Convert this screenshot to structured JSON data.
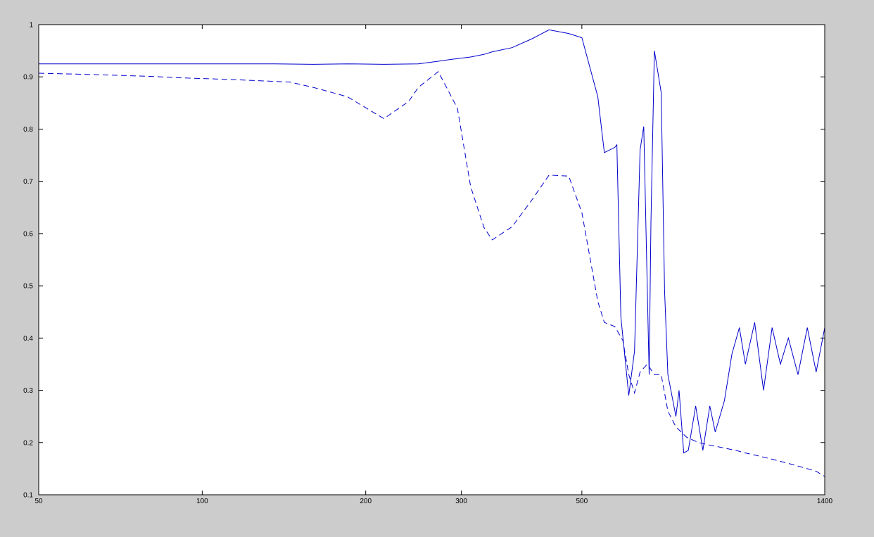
{
  "chart_data": {
    "type": "line",
    "title": "",
    "xlabel": "",
    "ylabel": "",
    "x_scale": "log",
    "xlim": [
      50,
      1400
    ],
    "ylim": [
      0.1,
      1.0
    ],
    "x_ticks": [
      50,
      100,
      200,
      300,
      500,
      1400
    ],
    "x_tick_labels": [
      "50",
      "100",
      "200",
      "300",
      "500",
      "1400"
    ],
    "y_ticks": [
      0.1,
      0.2,
      0.3,
      0.4,
      0.5,
      0.6,
      0.7,
      0.8,
      0.9,
      1.0
    ],
    "y_tick_labels": [
      "0.1",
      "0.2",
      "0.3",
      "0.4",
      "0.5",
      "0.6",
      "0.7",
      "0.8",
      "0.9",
      "1"
    ],
    "grid": false,
    "legend": false,
    "colors": {
      "series": "#0000cc",
      "figure_bg": "#cccccc",
      "axes_bg": "#ffffff",
      "axes": "#000000"
    },
    "series": [
      {
        "style": "solid",
        "x": [
          50,
          65,
          80,
          106,
          136,
          160,
          185,
          216,
          250,
          272,
          295,
          312,
          330,
          342,
          372,
          405,
          435,
          473,
          500,
          535,
          550,
          575,
          580,
          590,
          610,
          625,
          640,
          650,
          665,
          670,
          680,
          700,
          710,
          720,
          745,
          755,
          770,
          785,
          810,
          835,
          860,
          880,
          915,
          945,
          975,
          1000,
          1040,
          1080,
          1120,
          1160,
          1200,
          1250,
          1300,
          1350,
          1400
        ],
        "y": [
          0.925,
          0.925,
          0.925,
          0.925,
          0.925,
          0.924,
          0.925,
          0.924,
          0.925,
          0.93,
          0.935,
          0.938,
          0.943,
          0.948,
          0.956,
          0.973,
          0.99,
          0.983,
          0.975,
          0.862,
          0.755,
          0.765,
          0.77,
          0.44,
          0.29,
          0.375,
          0.76,
          0.805,
          0.33,
          0.62,
          0.95,
          0.87,
          0.49,
          0.33,
          0.25,
          0.3,
          0.18,
          0.185,
          0.27,
          0.185,
          0.27,
          0.22,
          0.28,
          0.37,
          0.42,
          0.35,
          0.43,
          0.3,
          0.42,
          0.35,
          0.4,
          0.33,
          0.42,
          0.335,
          0.42
        ]
      },
      {
        "style": "dashed",
        "x": [
          50,
          60,
          70,
          80,
          92,
          106,
          125,
          145,
          160,
          185,
          216,
          240,
          250,
          272,
          295,
          312,
          330,
          342,
          372,
          405,
          435,
          473,
          500,
          535,
          550,
          575,
          595,
          610,
          625,
          640,
          660,
          680,
          700,
          720,
          745,
          780,
          820,
          860,
          910,
          960,
          1000,
          1050,
          1100,
          1150,
          1200,
          1250,
          1300,
          1350,
          1400
        ],
        "y": [
          0.907,
          0.905,
          0.903,
          0.901,
          0.898,
          0.896,
          0.893,
          0.89,
          0.88,
          0.862,
          0.82,
          0.853,
          0.88,
          0.91,
          0.84,
          0.69,
          0.612,
          0.588,
          0.613,
          0.665,
          0.712,
          0.71,
          0.64,
          0.47,
          0.43,
          0.422,
          0.395,
          0.33,
          0.295,
          0.335,
          0.35,
          0.33,
          0.33,
          0.26,
          0.23,
          0.21,
          0.2,
          0.195,
          0.19,
          0.185,
          0.18,
          0.175,
          0.17,
          0.165,
          0.16,
          0.155,
          0.15,
          0.145,
          0.135
        ]
      }
    ]
  }
}
